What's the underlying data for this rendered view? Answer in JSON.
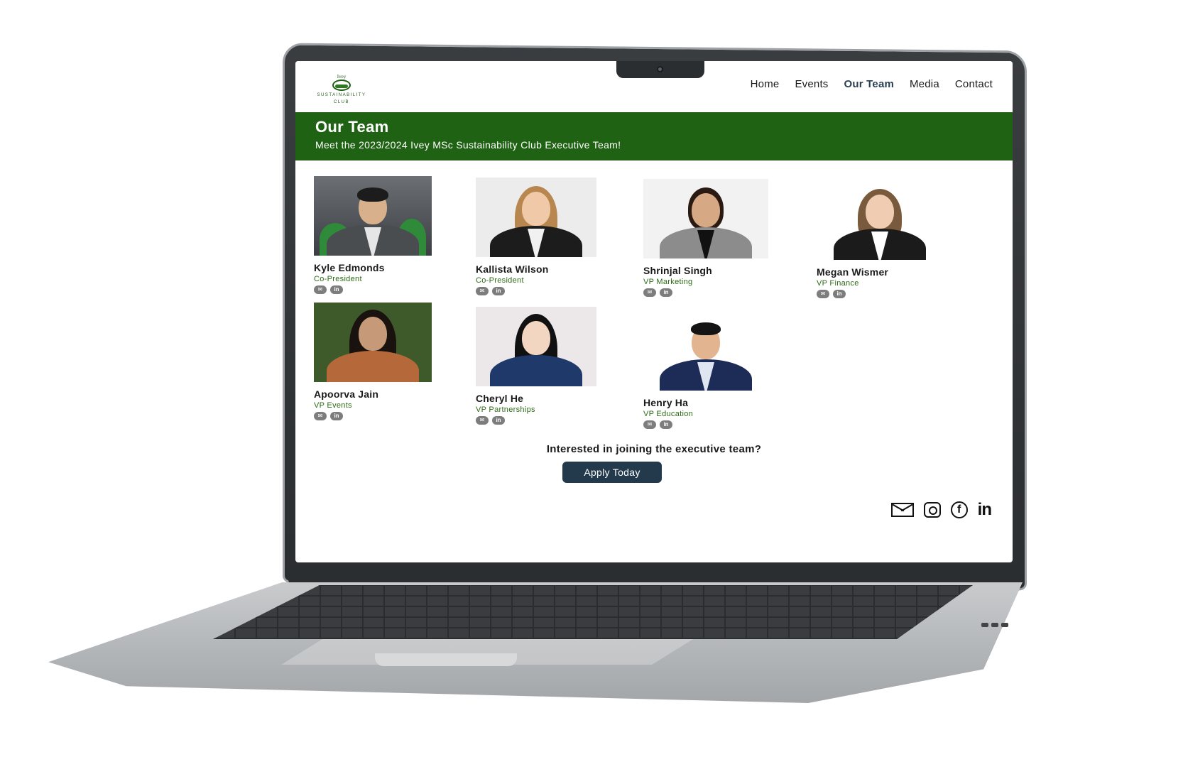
{
  "site": {
    "logo_top": "Ivey",
    "logo_line1": "SUSTAINABILITY",
    "logo_line2": "CLUB"
  },
  "nav": [
    {
      "label": "Home",
      "active": false
    },
    {
      "label": "Events",
      "active": false
    },
    {
      "label": "Our Team",
      "active": true
    },
    {
      "label": "Media",
      "active": false
    },
    {
      "label": "Contact",
      "active": false
    }
  ],
  "banner": {
    "title": "Our Team",
    "subtitle": "Meet the 2023/2024 Ivey MSc Sustainability Club Executive Team!"
  },
  "members": [
    {
      "name": "Kyle Edmonds",
      "role": "Co-President"
    },
    {
      "name": "Kallista Wilson",
      "role": "Co-President"
    },
    {
      "name": "Shrinjal Singh",
      "role": "VP Marketing"
    },
    {
      "name": "Megan Wismer",
      "role": "VP Finance"
    },
    {
      "name": "Apoorva Jain",
      "role": "VP Events"
    },
    {
      "name": "Cheryl He",
      "role": "VP Partnerships"
    },
    {
      "name": "Henry Ha",
      "role": "VP Education"
    }
  ],
  "social_chip": {
    "mail": "✉",
    "linkedin": "in"
  },
  "join": {
    "question": "Interested in joining the executive team?",
    "button": "Apply Today"
  },
  "footer": {
    "icons": [
      "mail-icon",
      "instagram-icon",
      "facebook-icon",
      "linkedin-icon"
    ],
    "facebook_glyph": "f",
    "linkedin_glyph": "in"
  },
  "colors": {
    "banner": "#1f6213",
    "role_text": "#2e6a16",
    "button": "#233a4d",
    "active_nav": "#2a3f55"
  }
}
